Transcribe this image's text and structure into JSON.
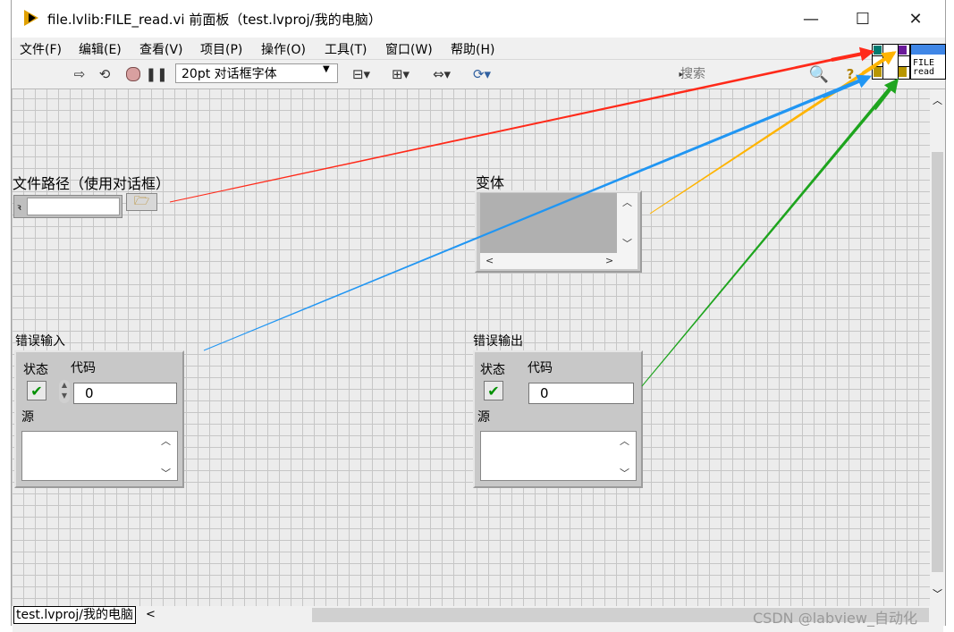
{
  "window": {
    "title": "file.lvlib:FILE_read.vi 前面板（test.lvproj/我的电脑）"
  },
  "window_controls": {
    "minimize": "—",
    "maximize": "☐",
    "close": "✕"
  },
  "menu": [
    "文件(F)",
    "编辑(E)",
    "查看(V)",
    "项目(P)",
    "操作(O)",
    "工具(T)",
    "窗口(W)",
    "帮助(H)"
  ],
  "toolbar": {
    "font_select": "20pt 对话框字体",
    "search_placeholder": "搜索",
    "icons": [
      "run-arrow-icon",
      "run-continuous-icon",
      "abort-icon",
      "pause-icon",
      "align-icon",
      "distribute-icon",
      "resize-icon",
      "reorder-icon",
      "search-icon",
      "help-icon"
    ]
  },
  "vi_icon": {
    "line1": "FILE",
    "line2": "read"
  },
  "controls": {
    "file_path": {
      "label": "文件路径（使用对话框）",
      "value": ""
    },
    "variant": {
      "label": "变体"
    },
    "error_in": {
      "label": "错误输入",
      "status_label": "状态",
      "code_label": "代码",
      "code_value": "0",
      "source_label": "源"
    },
    "error_out": {
      "label": "错误输出",
      "status_label": "状态",
      "code_label": "代码",
      "code_value": "0",
      "source_label": "源"
    }
  },
  "arrows": {
    "colors": [
      "#ff2a1a",
      "#ffb400",
      "#2196f3",
      "#1fa51f"
    ]
  },
  "status": {
    "project": "test.lvproj/我的电脑"
  },
  "watermark": "CSDN @labview_自动化"
}
